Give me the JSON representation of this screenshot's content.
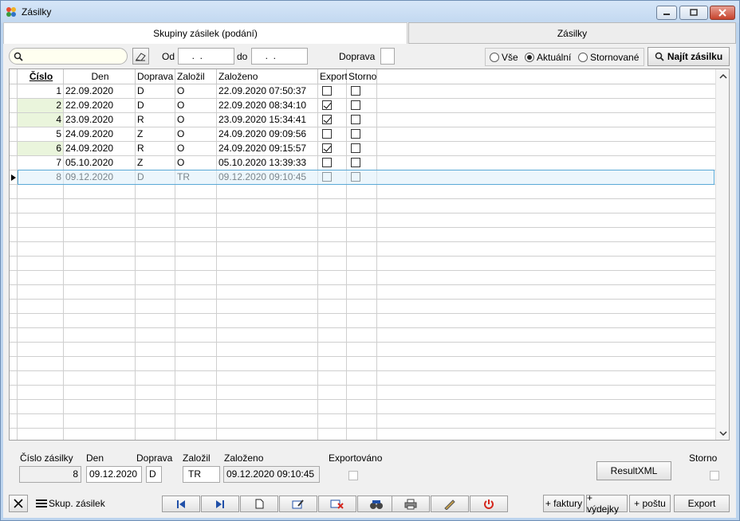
{
  "window": {
    "title": "Zásilky"
  },
  "tabs": [
    {
      "label": "Skupiny zásilek (podání)"
    },
    {
      "label": "Zásilky"
    }
  ],
  "filter": {
    "search_value": "",
    "od_label": "Od",
    "od_value": "  .  .",
    "do_label": "do",
    "do_value": "  .  .",
    "doprava_label": "Doprava",
    "doprava_value": "",
    "radio_options": [
      {
        "label": "Vše",
        "selected": false
      },
      {
        "label": "Aktuální",
        "selected": true
      },
      {
        "label": "Stornované",
        "selected": false
      }
    ],
    "find_button": "Najít zásilku"
  },
  "grid": {
    "columns": [
      "Číslo",
      "Den",
      "Doprava",
      "Založil",
      "Založeno",
      "Export",
      "Storno"
    ],
    "rows": [
      {
        "cislo": "1",
        "den": "22.09.2020",
        "doprava": "D",
        "zalozil": "O",
        "zalozeno": "22.09.2020 07:50:37",
        "export": false,
        "storno": false,
        "green": false
      },
      {
        "cislo": "2",
        "den": "22.09.2020",
        "doprava": "D",
        "zalozil": "O",
        "zalozeno": "22.09.2020 08:34:10",
        "export": true,
        "storno": false,
        "green": true
      },
      {
        "cislo": "4",
        "den": "23.09.2020",
        "doprava": "R",
        "zalozil": "O",
        "zalozeno": "23.09.2020 15:34:41",
        "export": true,
        "storno": false,
        "green": true
      },
      {
        "cislo": "5",
        "den": "24.09.2020",
        "doprava": "Z",
        "zalozil": "O",
        "zalozeno": "24.09.2020 09:09:56",
        "export": false,
        "storno": false,
        "green": false
      },
      {
        "cislo": "6",
        "den": "24.09.2020",
        "doprava": "R",
        "zalozil": "O",
        "zalozeno": "24.09.2020 09:15:57",
        "export": true,
        "storno": false,
        "green": true
      },
      {
        "cislo": "7",
        "den": "05.10.2020",
        "doprava": "Z",
        "zalozil": "O",
        "zalozeno": "05.10.2020 13:39:33",
        "export": false,
        "storno": false,
        "green": false
      },
      {
        "cislo": "8",
        "den": "09.12.2020",
        "doprava": "D",
        "zalozil": "TR",
        "zalozeno": "09.12.2020 09:10:45",
        "export": false,
        "storno": false,
        "green": false,
        "selected": true
      }
    ]
  },
  "detail": {
    "cislo_label": "Číslo zásilky",
    "cislo_value": "8",
    "den_label": "Den",
    "den_value": "09.12.2020",
    "doprava_label": "Doprava",
    "doprava_value": "D",
    "zalozil_label": "Založil",
    "zalozil_value": "TR",
    "zalozeno_label": "Založeno",
    "zalozeno_value": "09.12.2020 09:10:45",
    "exportovano_label": "Exportováno",
    "resultxml_button": "ResultXML",
    "storno_label": "Storno"
  },
  "bottom": {
    "skup_label": "Skup. zásilek",
    "faktury": "+ faktury",
    "vydejky": "+ výdejky",
    "postu": "+ poštu",
    "export": "Export"
  }
}
